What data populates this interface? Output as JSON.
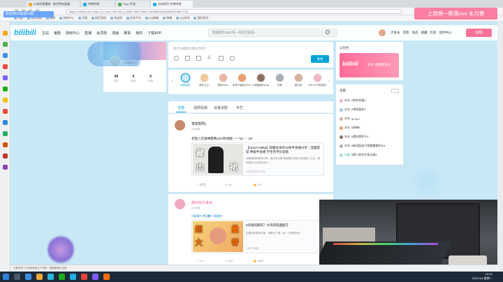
{
  "browser": {
    "tabs": [
      {
        "title": "20场同框播放 - 新世界加速器",
        "color": "#f2a93b",
        "active": false
      },
      {
        "title": "哔哩哔哩",
        "color": "#23ade5",
        "active": false
      },
      {
        "title": "Yoyo 手游",
        "color": "#4db34d",
        "active": false
      },
      {
        "title": "动态首页-哔哩哔哩",
        "color": "#23ade5",
        "active": true
      }
    ],
    "url": "https://t.bilibili.com/?spm_id_from=333.851.b_696e7465726e6174696f6e616c486561646572.29",
    "bookmarks": [
      "百度",
      "网址导航",
      "新闻",
      "游戏中心",
      "天猫",
      "网页游戏",
      "淘宝网",
      "优化平台",
      "QQ邮箱",
      "微博",
      "QQ空间",
      "我的首页"
    ]
  },
  "overlay": {
    "live_banner": "上周榜一鲸落ovo 本月票",
    "top_tag": "粉丝牌10级送vx群"
  },
  "header": {
    "logo": "bilibili",
    "nav": [
      "主站",
      "番剧",
      "游戏中心",
      "直播",
      "会员购",
      "漫画",
      "赛事",
      "我的",
      "下载APP"
    ],
    "search_placeholder": "跨越跨年2021第一份可可爱爱~",
    "user_nav": [
      "大会员",
      "消息",
      "动态",
      "收藏",
      "历史",
      "创作中心"
    ],
    "post_button": "投稿"
  },
  "profile": {
    "name": "芳缇asm",
    "stats": [
      {
        "value": "49",
        "label": "关注"
      },
      {
        "value": "0",
        "label": "粉丝"
      },
      {
        "value": "0",
        "label": "动态"
      }
    ]
  },
  "composer": {
    "placeholder": "有什么想和大家分享的？",
    "publish": "发布",
    "tools": [
      "emoji-icon",
      "image-icon",
      "vote-icon",
      "topic-icon",
      "schedule-icon",
      "clock-icon"
    ]
  },
  "ups": [
    {
      "name": "全部动态",
      "color": "#cdebf7",
      "selected": true
    },
    {
      "name": "我在凡尘",
      "color": "#f2c89a",
      "selected": false
    },
    {
      "name": "清风ihans",
      "color": "#e9b4a8",
      "selected": false
    },
    {
      "name": "和良子酱宝贝Honey",
      "color": "#e8a070",
      "selected": false
    },
    {
      "name": "小猫爱捕MyCat",
      "color": "#8e6e63",
      "selected": false
    },
    {
      "name": "芷像",
      "color": "#a7b0b9",
      "selected": false
    },
    {
      "name": "唐天承",
      "color": "#d5b29d",
      "selected": false
    },
    {
      "name": "为什么只有粉宝宝的",
      "color": "#f4b6c7",
      "selected": false
    }
  ],
  "feed_tabs": [
    "全部",
    "视频投稿",
    "追番追剧",
    "专栏"
  ],
  "posts": [
    {
      "author": "李想想阿。",
      "time": "1小时前",
      "text": "老铝儿可真棒两两3分3秒视频 ~ • ⁽⁽ଘ( ˊᵕˋ )ଓ⁾⁾",
      "video_title": "【164cm 58kg】短腿女孩的16条半身裙分享｜显瘦搭穿 神级半身裙 学生党平价穿搭",
      "video_desc": "这期视频带着来分享，最近有点懒 再接着以来给大家准备了之后，看到很多小伙伴的评论……",
      "video_meta": "1.3万  2020-12-09",
      "thumb_text_left": "藏",
      "thumb_text_left2": "肉",
      "thumb_text_right": "裙",
      "actions": [
        "转发",
        "38",
        "279"
      ]
    },
    {
      "author": "翻到我乐美食",
      "time": "1小时前",
      "topics": "#美食# #红薯# #美食#",
      "video_title": "5块钱的麻花？大块肉馅面配方",
      "video_desc": "如果你家里有红薯，请看这个哦，每一个都很好吃~",
      "video_meta": "1.5万  2天前",
      "thumb_text_1": "超",
      "thumb_text_2": "大",
      "thumb_text_3": "量",
      "thumb_text_4": "脊",
      "actions": [
        "14",
        "182",
        "4843"
      ]
    }
  ],
  "notice": {
    "title": "公告栏",
    "banner_logo": "bilibili",
    "banner_text": "城岁·直播星会员"
  },
  "topics_box": {
    "title": "话题",
    "items": [
      {
        "who": "来电",
        "tag": "#如何充值#",
        "color": "#f4b6c7"
      },
      {
        "who": "来电",
        "tag": "#考研留年#",
        "color": "#a6c8e8"
      },
      {
        "who": "来电",
        "tag": "#LPL#",
        "color": "#d5b29d"
      },
      {
        "who": "来电",
        "tag": "#原神#",
        "color": "#e8a070"
      },
      {
        "who": "来电",
        "tag": "#奥利奥饼干#",
        "color": "#8e6e63"
      },
      {
        "who": "来电",
        "tag": "#新冠疫苗只是最重要的头#",
        "color": "#a7b0b9"
      },
      {
        "who": "已经",
        "tag": "#明八联号开发出来#",
        "color": "#b2dfc5"
      }
    ]
  },
  "statusbar": {
    "text": "头条资讯 | 今天你有这几个资讯，更新都是大生命"
  },
  "taskbar": {
    "time": "19:24",
    "date": "2021/1/4 星期一"
  }
}
